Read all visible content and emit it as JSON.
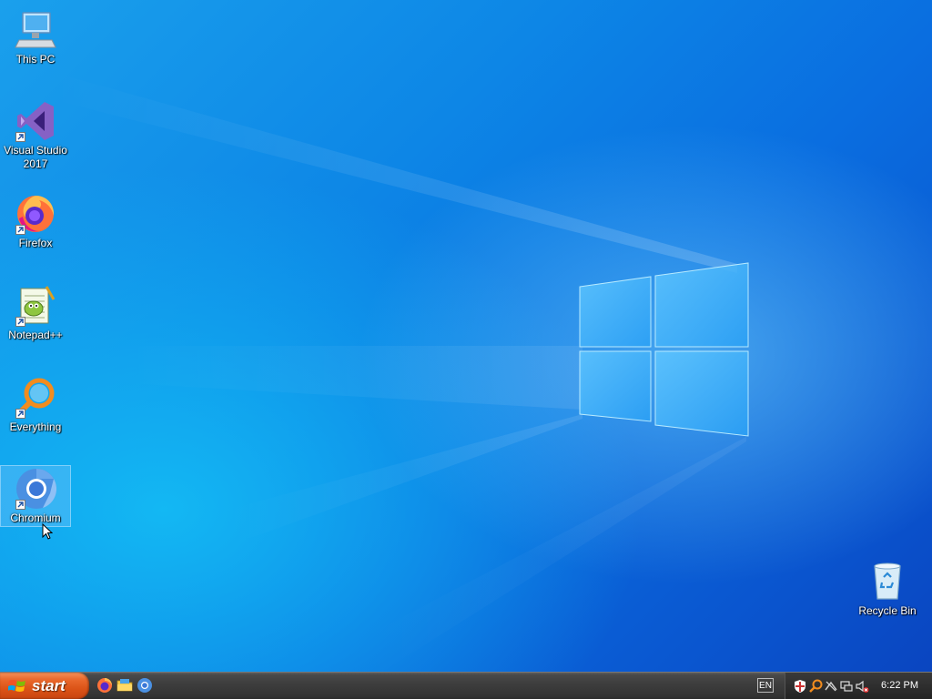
{
  "desktop": {
    "icons": [
      {
        "label_line1": "This PC",
        "label_line2": "",
        "icon": "computer-icon"
      },
      {
        "label_line1": "Visual Studio",
        "label_line2": "2017",
        "icon": "visual-studio-icon"
      },
      {
        "label_line1": "Firefox",
        "label_line2": "",
        "icon": "firefox-icon"
      },
      {
        "label_line1": "Notepad++",
        "label_line2": "",
        "icon": "notepadpp-icon"
      },
      {
        "label_line1": "Everything",
        "label_line2": "",
        "icon": "everything-search-icon"
      },
      {
        "label_line1": "Chromium",
        "label_line2": "",
        "icon": "chromium-icon",
        "selected": true
      },
      {
        "label_line1": "Recycle Bin",
        "label_line2": "",
        "icon": "recycle-bin-icon"
      }
    ]
  },
  "taskbar": {
    "start_label": "start",
    "quick_launch": [
      {
        "icon": "firefox-icon"
      },
      {
        "icon": "file-explorer-icon"
      },
      {
        "icon": "chromium-icon"
      }
    ],
    "language": "EN",
    "tray_icons": [
      "security-shield-icon",
      "everything-search-icon",
      "network-icon",
      "display-network-icon",
      "volume-muted-icon"
    ],
    "clock": "6:22 PM"
  },
  "colors": {
    "wallpaper_accent": "#0a6ee0",
    "start_button": "#dc5418",
    "taskbar": "#3e3e3e"
  }
}
